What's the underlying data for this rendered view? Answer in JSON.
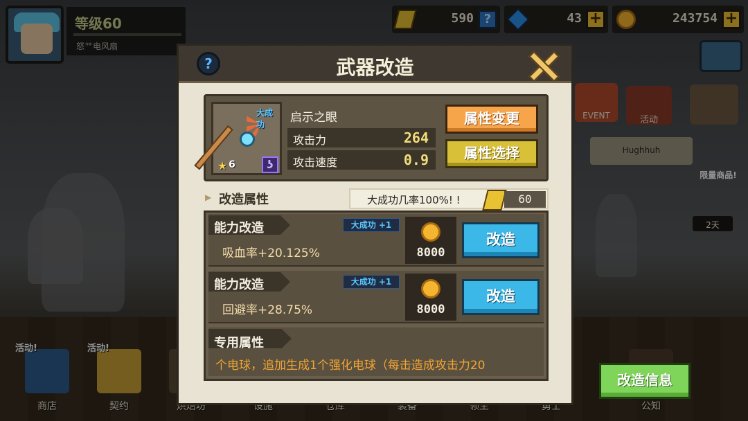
{
  "player": {
    "level": "等级60",
    "name": "怒艹电风扇"
  },
  "currencies": {
    "tickets": "590",
    "gems": "43",
    "gold": "243754",
    "help_glyph": "?",
    "plus_glyph": "+"
  },
  "side": {
    "event_label": "EVENT",
    "activity_label": "活动",
    "banner_name": "Hughhuh",
    "limited_label": "限量商品!",
    "timer": "2天"
  },
  "modal": {
    "title": "武器改造",
    "help_glyph": "?",
    "weapon": {
      "name": "启示之眼",
      "great_success_tag": "大成功",
      "stars": "6",
      "attack_label": "攻击力",
      "attack_value": "264",
      "speed_label": "攻击速度",
      "speed_value": "0.9"
    },
    "buttons": {
      "change_attr": "属性变更",
      "select_attr": "属性选择"
    },
    "section": {
      "title": "改造属性",
      "chance_text": "大成功几率100%! !",
      "ticket_count": "60"
    },
    "options": [
      {
        "title": "能力改造",
        "bonus": "大成功 +1",
        "value": "吸血率+20.125%",
        "cost": "8000",
        "button": "改造"
      },
      {
        "title": "能力改造",
        "bonus": "大成功 +1",
        "value": "回避率+28.75%",
        "cost": "8000",
        "button": "改造"
      }
    ],
    "special": {
      "title": "专用属性",
      "text": "个电球，追加生成1个强化电球（每击造成攻击力20"
    }
  },
  "bottom_nav": {
    "items": [
      {
        "label": "商店",
        "tag": "活动!"
      },
      {
        "label": "契约",
        "tag": "活动!"
      },
      {
        "label": "烘焙坊",
        "tag": ""
      },
      {
        "label": "设施",
        "tag": ""
      },
      {
        "label": "仓库",
        "tag": ""
      },
      {
        "label": "装备",
        "tag": ""
      },
      {
        "label": "领主",
        "tag": ""
      },
      {
        "label": "勇士",
        "tag": ""
      },
      {
        "label": "公知",
        "tag": ""
      }
    ]
  },
  "info_button": "改造信息",
  "colors": {
    "accent_blue": "#3bb7e8",
    "accent_orange": "#f7a54a",
    "accent_gold": "#d8c038",
    "accent_green": "#7fd55a",
    "great_success_blue": "#5ac7ff"
  }
}
